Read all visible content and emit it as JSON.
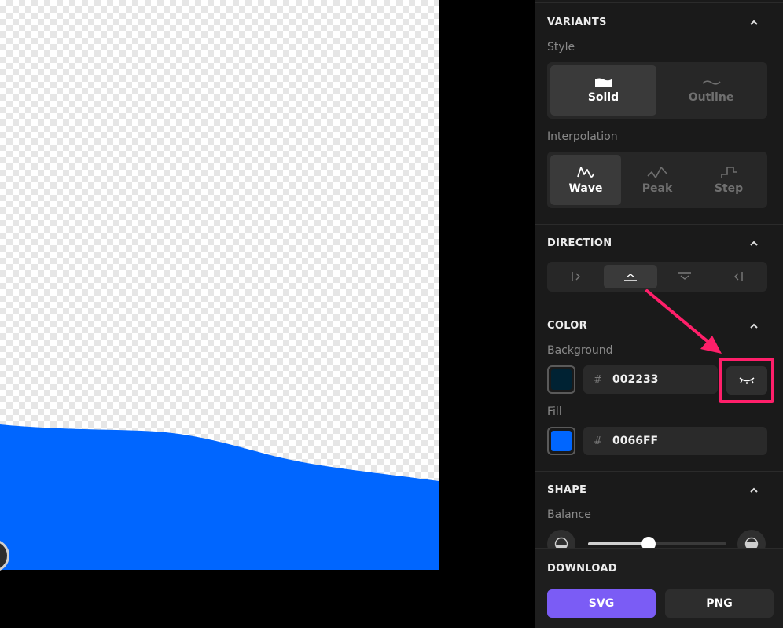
{
  "variants": {
    "title": "VARIANTS",
    "style_label": "Style",
    "style_options": [
      {
        "label": "Solid",
        "icon": "solid-wave-icon",
        "active": true
      },
      {
        "label": "Outline",
        "icon": "outline-wave-icon",
        "active": false
      }
    ],
    "interpolation_label": "Interpolation",
    "interpolation_options": [
      {
        "label": "Wave",
        "icon": "wave-icon",
        "active": true
      },
      {
        "label": "Peak",
        "icon": "peak-icon",
        "active": false
      },
      {
        "label": "Step",
        "icon": "step-icon",
        "active": false
      }
    ]
  },
  "direction": {
    "title": "DIRECTION",
    "options": [
      {
        "icon": "direction-right-icon",
        "active": false
      },
      {
        "icon": "direction-up-icon",
        "active": true
      },
      {
        "icon": "direction-down-icon",
        "active": false
      },
      {
        "icon": "direction-left-icon",
        "active": false
      }
    ]
  },
  "color": {
    "title": "COLOR",
    "background_label": "Background",
    "background_hash": "#",
    "background_hex": "002233",
    "background_color": "#002233",
    "fill_label": "Fill",
    "fill_hash": "#",
    "fill_hex": "0066FF",
    "fill_color": "#0066FF",
    "visibility_icon": "eye-closed-icon"
  },
  "shape": {
    "title": "SHAPE",
    "balance_label": "Balance",
    "balance_value": 0.44
  },
  "download": {
    "title": "DOWNLOAD",
    "svg_label": "SVG",
    "png_label": "PNG"
  },
  "annotation": {
    "highlight_color": "#ff1f6a"
  }
}
